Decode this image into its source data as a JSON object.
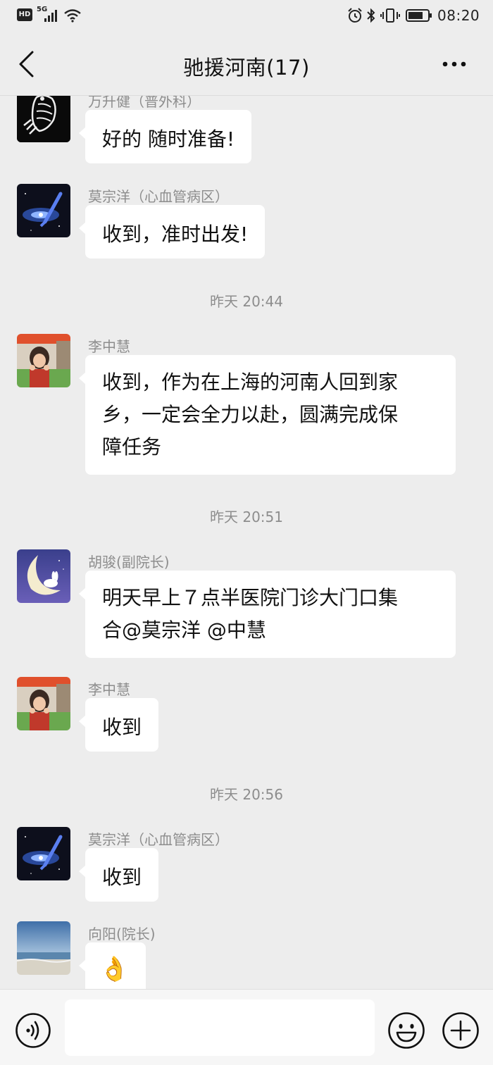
{
  "status_bar": {
    "hd_badge": "HD",
    "network_type": "5G",
    "time": "08:20",
    "icons": [
      "hd-icon",
      "signal-icon",
      "wifi-icon",
      "alarm-icon",
      "bluetooth-icon",
      "vibrate-icon",
      "battery-icon"
    ]
  },
  "nav": {
    "title": "驰援河南(17)",
    "back_icon": "chevron-left-icon",
    "more_icon": "more-dots-icon"
  },
  "messages": [
    {
      "sender": "万升健（普外科）",
      "text": "好的 随时准备!",
      "avatar": "skeleton-hand-avatar"
    },
    {
      "sender": "莫宗洋（心血管病区）",
      "text": "收到，准时出发!",
      "avatar": "galaxy-avatar"
    },
    {
      "timestamp": "昨天 20:44"
    },
    {
      "sender": "李中慧",
      "text_lines": [
        "收到，作为在上海的河南人回到家",
        "乡，一定会全力以赴，圆满完成保",
        "障任务"
      ],
      "avatar": "girl-photo-avatar"
    },
    {
      "timestamp": "昨天 20:51"
    },
    {
      "sender": "胡骏(副院长)",
      "text_lines": [
        "明天早上７点半医院门诊大门口集",
        "合@莫宗洋 @中慧"
      ],
      "avatar": "moon-rabbit-avatar"
    },
    {
      "sender": "李中慧",
      "text": "收到",
      "avatar": "girl-photo-avatar"
    },
    {
      "timestamp": "昨天 20:56"
    },
    {
      "sender": "莫宗洋（心血管病区）",
      "text": "收到",
      "avatar": "galaxy-avatar"
    },
    {
      "sender": "向阳(院长)",
      "emoji": "👌",
      "avatar": "beach-photo-avatar"
    }
  ],
  "input_bar": {
    "placeholder": "",
    "value": "",
    "voice_icon": "voice-icon",
    "emoji_icon": "emoji-icon",
    "plus_icon": "plus-icon"
  },
  "colors": {
    "background": "#ededed",
    "bubble": "#ffffff",
    "meta_text": "#8d8d8d",
    "title_text": "#111111"
  }
}
